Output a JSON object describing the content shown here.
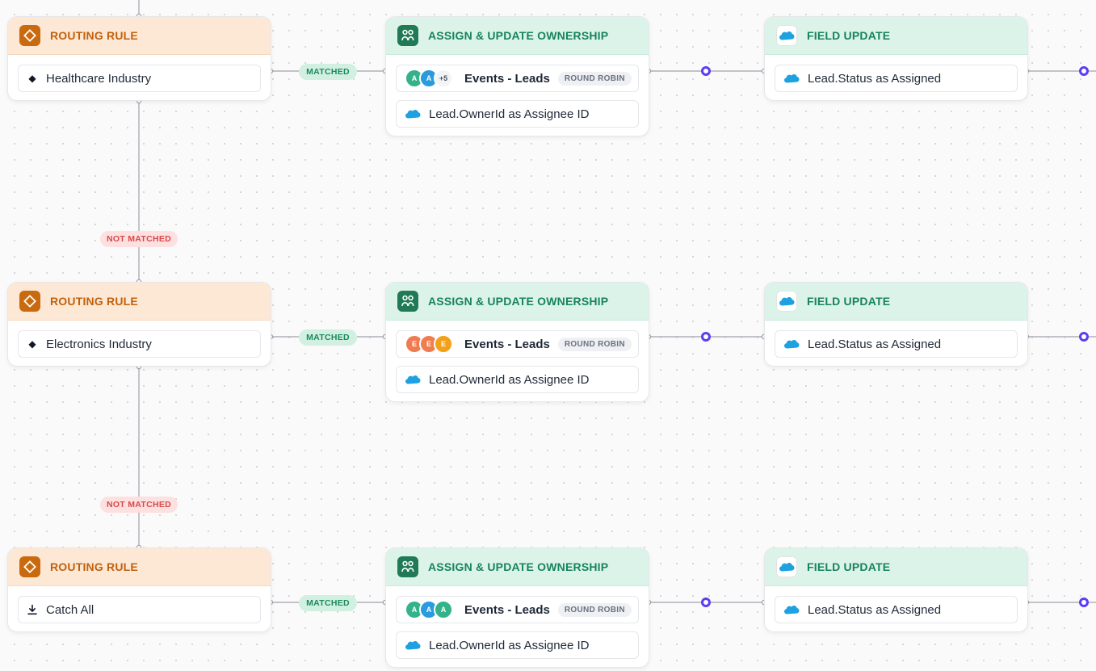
{
  "rows": [
    {
      "routing": {
        "header": "ROUTING RULE",
        "label": "Healthcare Industry",
        "icon": "diamond-icon"
      },
      "matched_label": "MATCHED",
      "assign": {
        "header": "ASSIGN & UPDATE OWNERSHIP",
        "avatars": [
          {
            "letter": "A",
            "color": "#34b38a"
          },
          {
            "letter": "A",
            "color": "#2b9be0"
          }
        ],
        "more": "+5",
        "event_name": "Events - Leads",
        "mode": "ROUND ROBIN",
        "owner_update": "Lead.OwnerId as Assignee ID"
      },
      "field": {
        "header": "FIELD UPDATE",
        "update": "Lead.Status as Assigned"
      }
    },
    {
      "routing": {
        "header": "ROUTING RULE",
        "label": "Electronics Industry",
        "icon": "diamond-icon"
      },
      "matched_label": "MATCHED",
      "assign": {
        "header": "ASSIGN & UPDATE OWNERSHIP",
        "avatars": [
          {
            "letter": "E",
            "color": "#ef7b51"
          },
          {
            "letter": "E",
            "color": "#f07d4e"
          },
          {
            "letter": "E",
            "color": "#f3a11b"
          }
        ],
        "more": "",
        "event_name": "Events - Leads",
        "mode": "ROUND ROBIN",
        "owner_update": "Lead.OwnerId as Assignee ID"
      },
      "field": {
        "header": "FIELD UPDATE",
        "update": "Lead.Status as Assigned"
      }
    },
    {
      "routing": {
        "header": "ROUTING RULE",
        "label": "Catch All",
        "icon": "download-icon"
      },
      "matched_label": "MATCHED",
      "assign": {
        "header": "ASSIGN & UPDATE OWNERSHIP",
        "avatars": [
          {
            "letter": "A",
            "color": "#34b38a"
          },
          {
            "letter": "A",
            "color": "#2b9be0"
          },
          {
            "letter": "A",
            "color": "#34b38a"
          }
        ],
        "more": "",
        "event_name": "Events - Leads",
        "mode": "ROUND ROBIN",
        "owner_update": "Lead.OwnerId as Assignee ID"
      },
      "field": {
        "header": "FIELD UPDATE",
        "update": "Lead.Status as Assigned"
      }
    }
  ],
  "not_matched_labels": [
    "NOT MATCHED",
    "NOT MATCHED"
  ],
  "colors": {
    "connector_line": "#a1a1aa",
    "endpoint_node": "#5b3df5",
    "routing_header_bg": "#fde8d6",
    "routing_text": "#c2610c",
    "action_header_bg": "#dcf3ea",
    "action_text": "#17845a",
    "salesforce_blue": "#1ea1e0"
  }
}
